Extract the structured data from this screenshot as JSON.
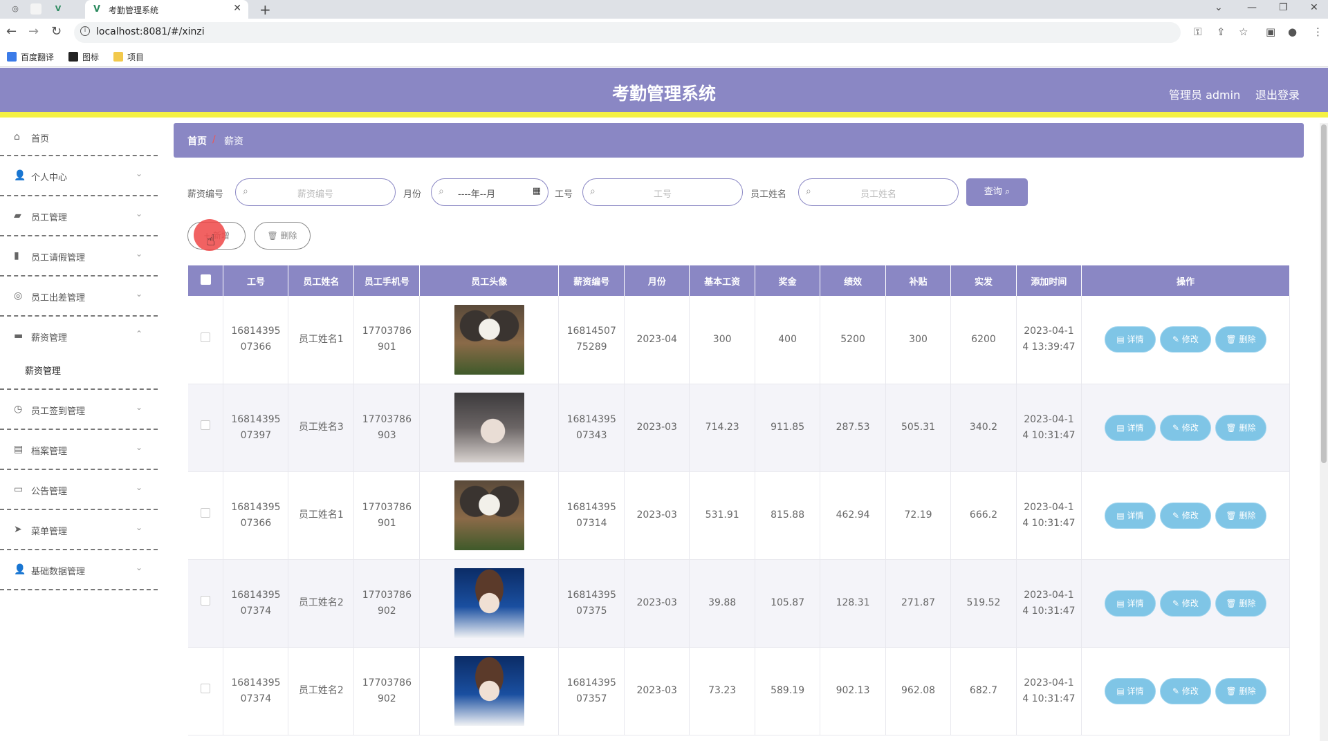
{
  "browser": {
    "tab_title": "考勤管理系统",
    "url": "localhost:8081/#/xinzi",
    "bookmarks": [
      "百度翻译",
      "图标",
      "项目"
    ]
  },
  "header": {
    "title": "考勤管理系统",
    "user": "管理员 admin",
    "logout": "退出登录"
  },
  "sidebar": {
    "items": [
      {
        "label": "首页",
        "icon": "home-icon"
      },
      {
        "label": "个人中心",
        "icon": "user-icon"
      },
      {
        "label": "员工管理",
        "icon": "briefcase-icon"
      },
      {
        "label": "员工请假管理",
        "icon": "bar-chart-icon"
      },
      {
        "label": "员工出差管理",
        "icon": "target-icon"
      },
      {
        "label": "薪资管理",
        "icon": "wallet-icon"
      },
      {
        "label": "员工签到管理",
        "icon": "clock-icon"
      },
      {
        "label": "档案管理",
        "icon": "clipboard-icon"
      },
      {
        "label": "公告管理",
        "icon": "monitor-icon"
      },
      {
        "label": "菜单管理",
        "icon": "send-icon"
      },
      {
        "label": "基础数据管理",
        "icon": "user-icon"
      }
    ],
    "submenu": "薪资管理"
  },
  "breadcrumb": {
    "home": "首页",
    "sep": "/",
    "current": "薪资"
  },
  "search": {
    "salary_no_label": "薪资编号",
    "salary_no_placeholder": "薪资编号",
    "month_label": "月份",
    "month_value": "----年--月",
    "emp_no_label": "工号",
    "emp_no_placeholder": "工号",
    "emp_name_label": "员工姓名",
    "emp_name_placeholder": "员工姓名",
    "query_btn": "查询"
  },
  "actions": {
    "add": "+ 新增",
    "delete": "删除"
  },
  "table": {
    "headers": [
      "工号",
      "员工姓名",
      "员工手机号",
      "员工头像",
      "薪资编号",
      "月份",
      "基本工资",
      "奖金",
      "绩效",
      "补贴",
      "实发",
      "添加时间",
      "操作"
    ],
    "op_labels": {
      "detail": "详情",
      "edit": "修改",
      "delete": "删除"
    },
    "rows": [
      {
        "emp_no": [
          "16814395",
          "07366"
        ],
        "name": "员工姓名1",
        "phone": [
          "17703786",
          "901"
        ],
        "avatar": "cat",
        "salary_no": [
          "16814507",
          "75289"
        ],
        "month": "2023-04",
        "base": "300",
        "bonus": "400",
        "perf": "5200",
        "subsidy": "300",
        "net": "6200",
        "time": [
          "2023-04-1",
          "4 13:39:47"
        ]
      },
      {
        "emp_no": [
          "16814395",
          "07397"
        ],
        "name": "员工姓名3",
        "phone": [
          "17703786",
          "903"
        ],
        "avatar": "girl",
        "salary_no": [
          "16814395",
          "07343"
        ],
        "month": "2023-03",
        "base": "714.23",
        "bonus": "911.85",
        "perf": "287.53",
        "subsidy": "505.31",
        "net": "340.2",
        "time": [
          "2023-04-1",
          "4 10:31:47"
        ]
      },
      {
        "emp_no": [
          "16814395",
          "07366"
        ],
        "name": "员工姓名1",
        "phone": [
          "17703786",
          "901"
        ],
        "avatar": "cat",
        "salary_no": [
          "16814395",
          "07314"
        ],
        "month": "2023-03",
        "base": "531.91",
        "bonus": "815.88",
        "perf": "462.94",
        "subsidy": "72.19",
        "net": "666.2",
        "time": [
          "2023-04-1",
          "4 10:31:47"
        ]
      },
      {
        "emp_no": [
          "16814395",
          "07374"
        ],
        "name": "员工姓名2",
        "phone": [
          "17703786",
          "902"
        ],
        "avatar": "boy",
        "salary_no": [
          "16814395",
          "07375"
        ],
        "month": "2023-03",
        "base": "39.88",
        "bonus": "105.87",
        "perf": "128.31",
        "subsidy": "271.87",
        "net": "519.52",
        "time": [
          "2023-04-1",
          "4 10:31:47"
        ]
      },
      {
        "emp_no": [
          "16814395",
          "07374"
        ],
        "name": "员工姓名2",
        "phone": [
          "17703786",
          "902"
        ],
        "avatar": "boy",
        "salary_no": [
          "16814395",
          "07357"
        ],
        "month": "2023-03",
        "base": "73.23",
        "bonus": "589.19",
        "perf": "902.13",
        "subsidy": "962.08",
        "net": "682.7",
        "time": [
          "2023-04-1",
          "4 10:31:47"
        ]
      }
    ]
  },
  "colors": {
    "primary": "#8a87c4",
    "accent_bar": "#f5f143",
    "op_button": "#7fc5e6",
    "click_marker": "#ee4646"
  }
}
